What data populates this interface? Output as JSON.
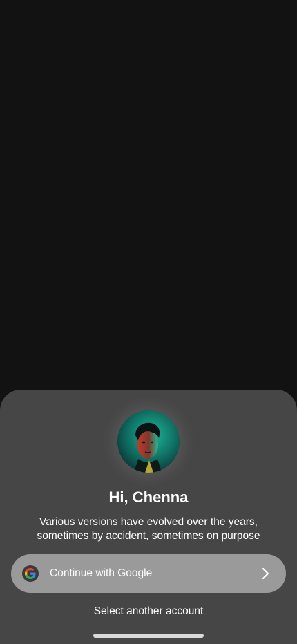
{
  "sheet": {
    "greeting": "Hi, Chenna",
    "subtitle": "Various versions have evolved over the years, sometimes by accident, sometimes on purpose",
    "google_button": {
      "label": "Continue with Google",
      "icon": "google-icon",
      "trailing_icon": "chevron-right-icon"
    },
    "secondary_action": "Select another account"
  },
  "colors": {
    "background": "#121212",
    "sheet": "#464646",
    "button": "#9a9a9a",
    "text": "#ffffff"
  }
}
